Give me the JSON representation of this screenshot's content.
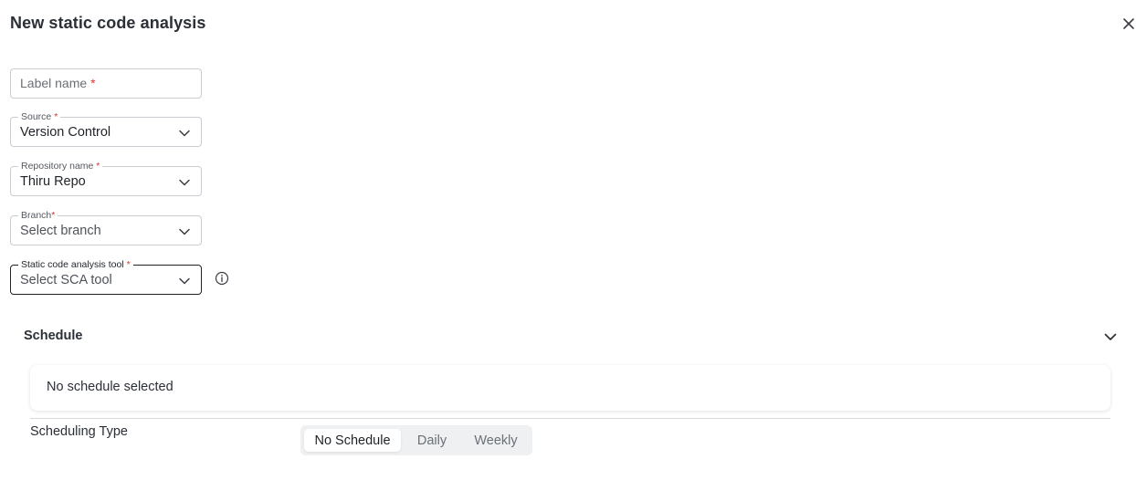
{
  "dialog": {
    "title": "New static code analysis",
    "close_icon": "close-icon"
  },
  "form": {
    "label_name": {
      "placeholder": "Label name",
      "required_mark": "*"
    },
    "source": {
      "legend": "Source",
      "required_mark": "*",
      "value": "Version Control"
    },
    "repository": {
      "legend": "Repository name",
      "required_mark": "*",
      "value": "Thiru Repo"
    },
    "branch": {
      "legend": "Branch",
      "required_mark": "*",
      "value": "Select branch"
    },
    "sca_tool": {
      "legend": "Static code analysis tool",
      "required_mark": "*",
      "value": "Select SCA tool",
      "info_icon": "info-icon"
    }
  },
  "schedule": {
    "title": "Schedule",
    "summary": "No schedule selected",
    "type_label": "Scheduling Type",
    "options": [
      "No Schedule",
      "Daily",
      "Weekly"
    ],
    "selected": "No Schedule"
  },
  "colors": {
    "required": "#d93838",
    "text": "#1f2328",
    "border": "#c9ccd1",
    "segment_bg": "#eef0f2"
  }
}
